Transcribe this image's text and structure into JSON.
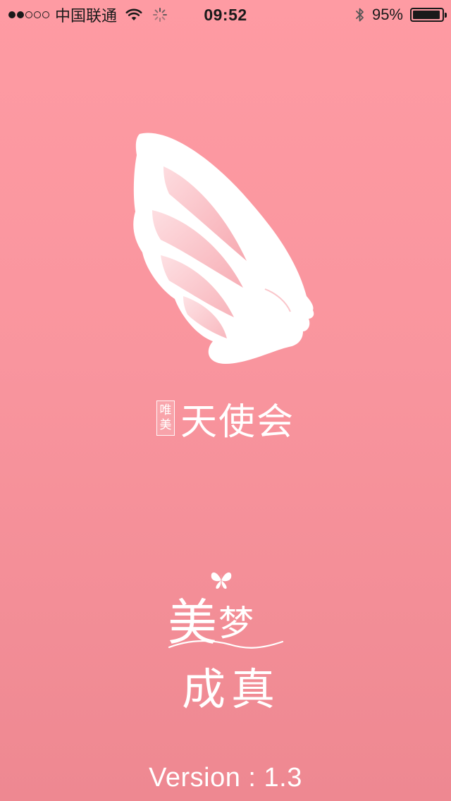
{
  "status_bar": {
    "signal_filled": 2,
    "signal_total": 5,
    "carrier": "中国联通",
    "time": "09:52",
    "battery_percent": "95%",
    "battery_level": 0.95,
    "icons": [
      "wifi-icon",
      "activity-spinner-icon",
      "bluetooth-icon",
      "battery-icon"
    ]
  },
  "brand": {
    "seal_chars": [
      "唯",
      "美"
    ],
    "name": "天使会",
    "logo_icon": "angel-wing-face-logo"
  },
  "slogan": {
    "line1_a": "美",
    "line1_b": "梦",
    "line2": "成真",
    "decoration_icon": "butterfly-icon"
  },
  "version_text": "Version : 1.3",
  "colors": {
    "background_top": "#fe9ba3",
    "background_bottom": "#ee8891",
    "foreground": "#ffffff",
    "status_text": "#1a1a1a"
  }
}
